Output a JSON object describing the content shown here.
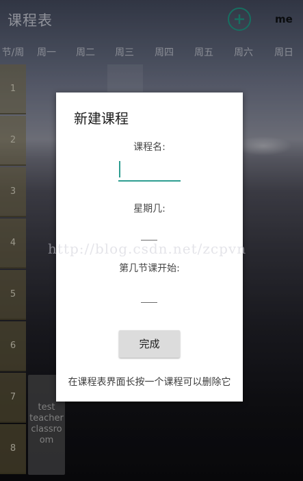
{
  "app": {
    "title": "课程表",
    "me_label": "me"
  },
  "colors": {
    "accent": "#2d9d90",
    "add_ring": "#1e8f7d"
  },
  "week_header": [
    "节/周",
    "周一",
    "周二",
    "周三",
    "周四",
    "周五",
    "周六",
    "周日"
  ],
  "periods": [
    "1",
    "2",
    "3",
    "4",
    "5",
    "6",
    "7",
    "8"
  ],
  "course": {
    "lines": [
      "test",
      "teacher",
      "classro",
      "om"
    ]
  },
  "dialog": {
    "title": "新建课程",
    "name_label": "课程名:",
    "name_value": "",
    "weekday_label": "星期几:",
    "start_label": "第几节课开始:",
    "done_label": "完成",
    "hint": "在课程表界面长按一个课程可以删除它"
  },
  "watermark": "http://blog.csdn.net/zcpvn"
}
